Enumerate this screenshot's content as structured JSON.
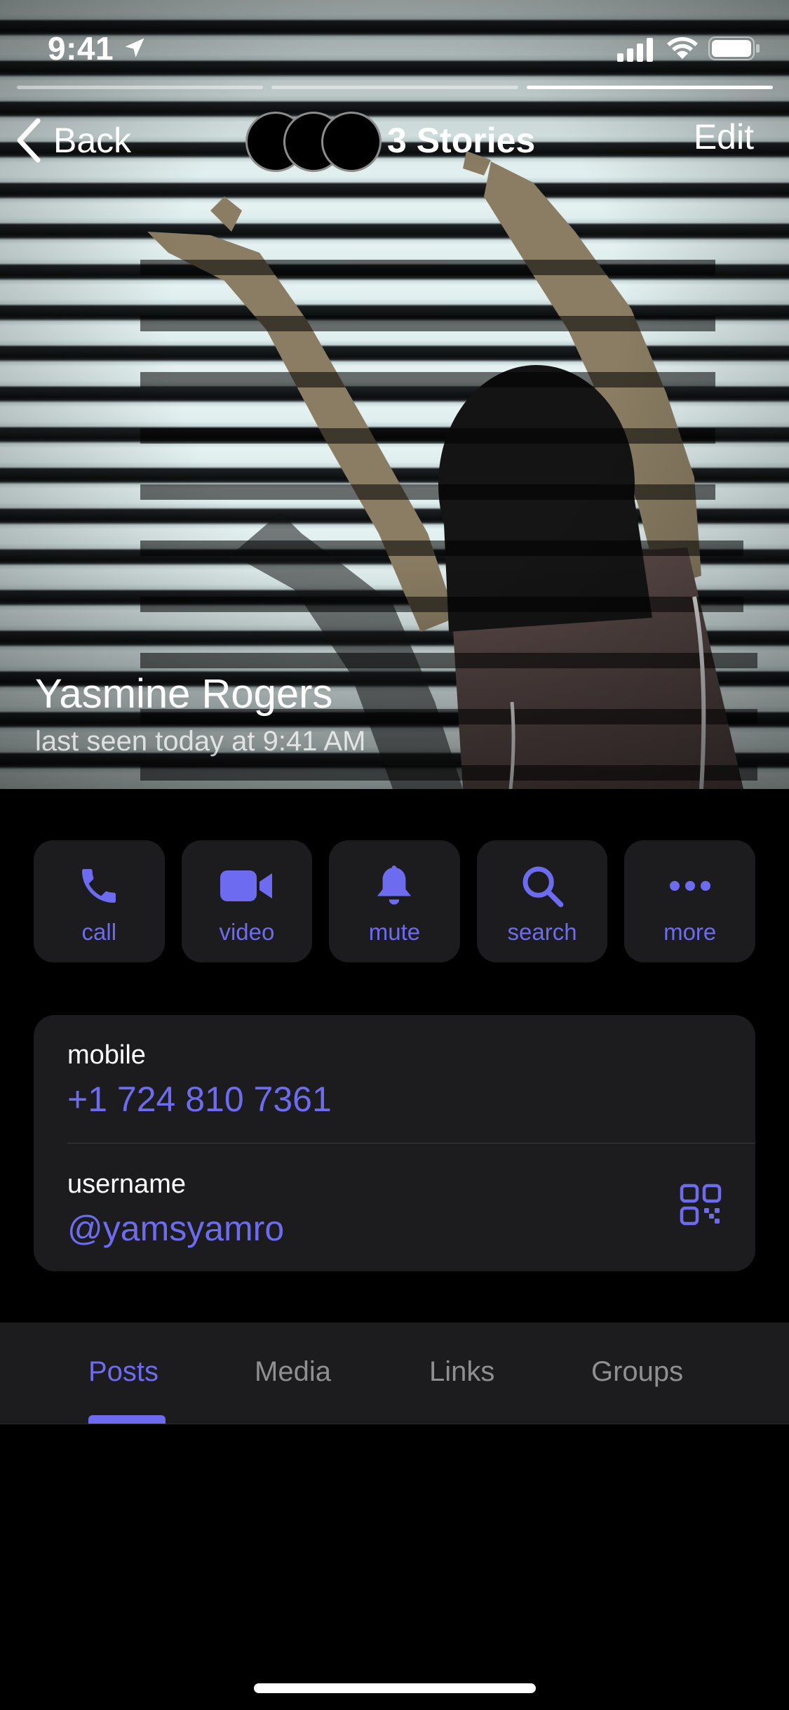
{
  "status_bar": {
    "time": "9:41"
  },
  "header": {
    "back_label": "Back",
    "stories_label": "3 Stories",
    "edit_label": "Edit"
  },
  "story_progress": {
    "count": 3,
    "active_index": 2
  },
  "profile": {
    "name": "Yasmine Rogers",
    "last_seen": "last seen today at 9:41 AM"
  },
  "actions": [
    {
      "label": "call",
      "icon": "phone-icon"
    },
    {
      "label": "video",
      "icon": "video-camera-icon"
    },
    {
      "label": "mute",
      "icon": "bell-icon"
    },
    {
      "label": "search",
      "icon": "search-icon"
    },
    {
      "label": "more",
      "icon": "more-dots-icon"
    }
  ],
  "info": {
    "mobile_label": "mobile",
    "mobile_value": "+1 724 810 7361",
    "username_label": "username",
    "username_value": "@yamsyamro"
  },
  "tabs": [
    {
      "label": "Posts",
      "active": true
    },
    {
      "label": "Media",
      "active": false
    },
    {
      "label": "Links",
      "active": false
    },
    {
      "label": "Groups",
      "active": false
    }
  ],
  "colors": {
    "accent": "#6d6cf0",
    "card_bg": "#1c1c1e",
    "background": "#000000"
  }
}
